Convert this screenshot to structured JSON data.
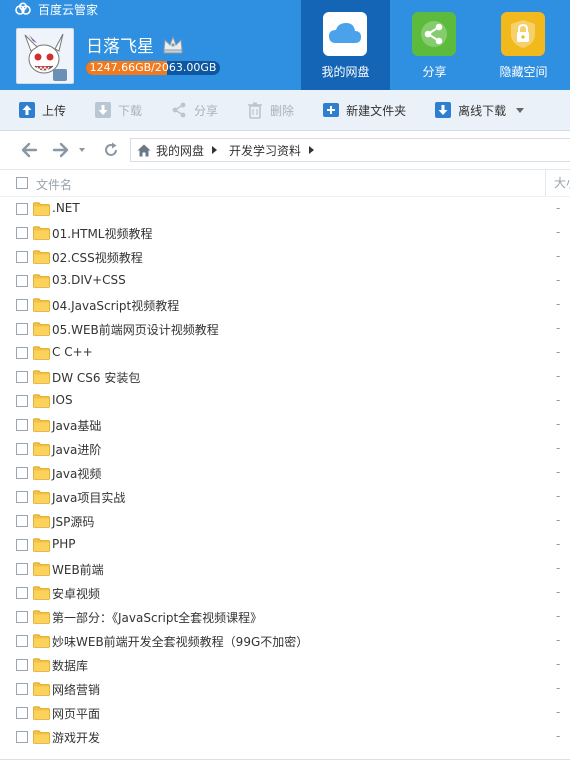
{
  "app": {
    "title": "百度云管家"
  },
  "user": {
    "name": "日落飞星",
    "quota_text": "1247.66GB/2063.00GB",
    "quota_used_fraction": 0.605
  },
  "nav": [
    {
      "label": "我的网盘",
      "icon": "cloud-icon",
      "active": true
    },
    {
      "label": "分享",
      "icon": "share-icon",
      "active": false
    },
    {
      "label": "隐藏空间",
      "icon": "lock-icon",
      "active": false
    }
  ],
  "toolbar": {
    "upload": "上传",
    "download": "下载",
    "share": "分享",
    "delete": "删除",
    "new_folder": "新建文件夹",
    "offline_download": "离线下载"
  },
  "breadcrumb": {
    "root": "我的网盘",
    "current": "开发学习资料"
  },
  "list": {
    "col_name": "文件名",
    "col_size": "大小",
    "files": [
      {
        "name": ".NET",
        "size": "-"
      },
      {
        "name": "01.HTML视频教程",
        "size": "-"
      },
      {
        "name": "02.CSS视频教程",
        "size": "-"
      },
      {
        "name": "03.DIV+CSS",
        "size": "-"
      },
      {
        "name": "04.JavaScript视频教程",
        "size": "-"
      },
      {
        "name": "05.WEB前端网页设计视频教程",
        "size": "-"
      },
      {
        "name": "C  C++",
        "size": "-"
      },
      {
        "name": "DW CS6 安装包",
        "size": "-"
      },
      {
        "name": "IOS",
        "size": "-"
      },
      {
        "name": "Java基础",
        "size": "-"
      },
      {
        "name": "Java进阶",
        "size": "-"
      },
      {
        "name": "Java视频",
        "size": "-"
      },
      {
        "name": "Java项目实战",
        "size": "-"
      },
      {
        "name": "JSP源码",
        "size": "-"
      },
      {
        "name": "PHP",
        "size": "-"
      },
      {
        "name": "WEB前端",
        "size": "-"
      },
      {
        "name": "安卓视频",
        "size": "-"
      },
      {
        "name": "第一部分：《JavaScript全套视频课程》",
        "size": "-"
      },
      {
        "name": "妙味WEB前端开发全套视频教程（99G不加密）",
        "size": "-"
      },
      {
        "name": "数据库",
        "size": "-"
      },
      {
        "name": "网络营销",
        "size": "-"
      },
      {
        "name": "网页平面",
        "size": "-"
      },
      {
        "name": "游戏开发",
        "size": "-"
      }
    ]
  }
}
